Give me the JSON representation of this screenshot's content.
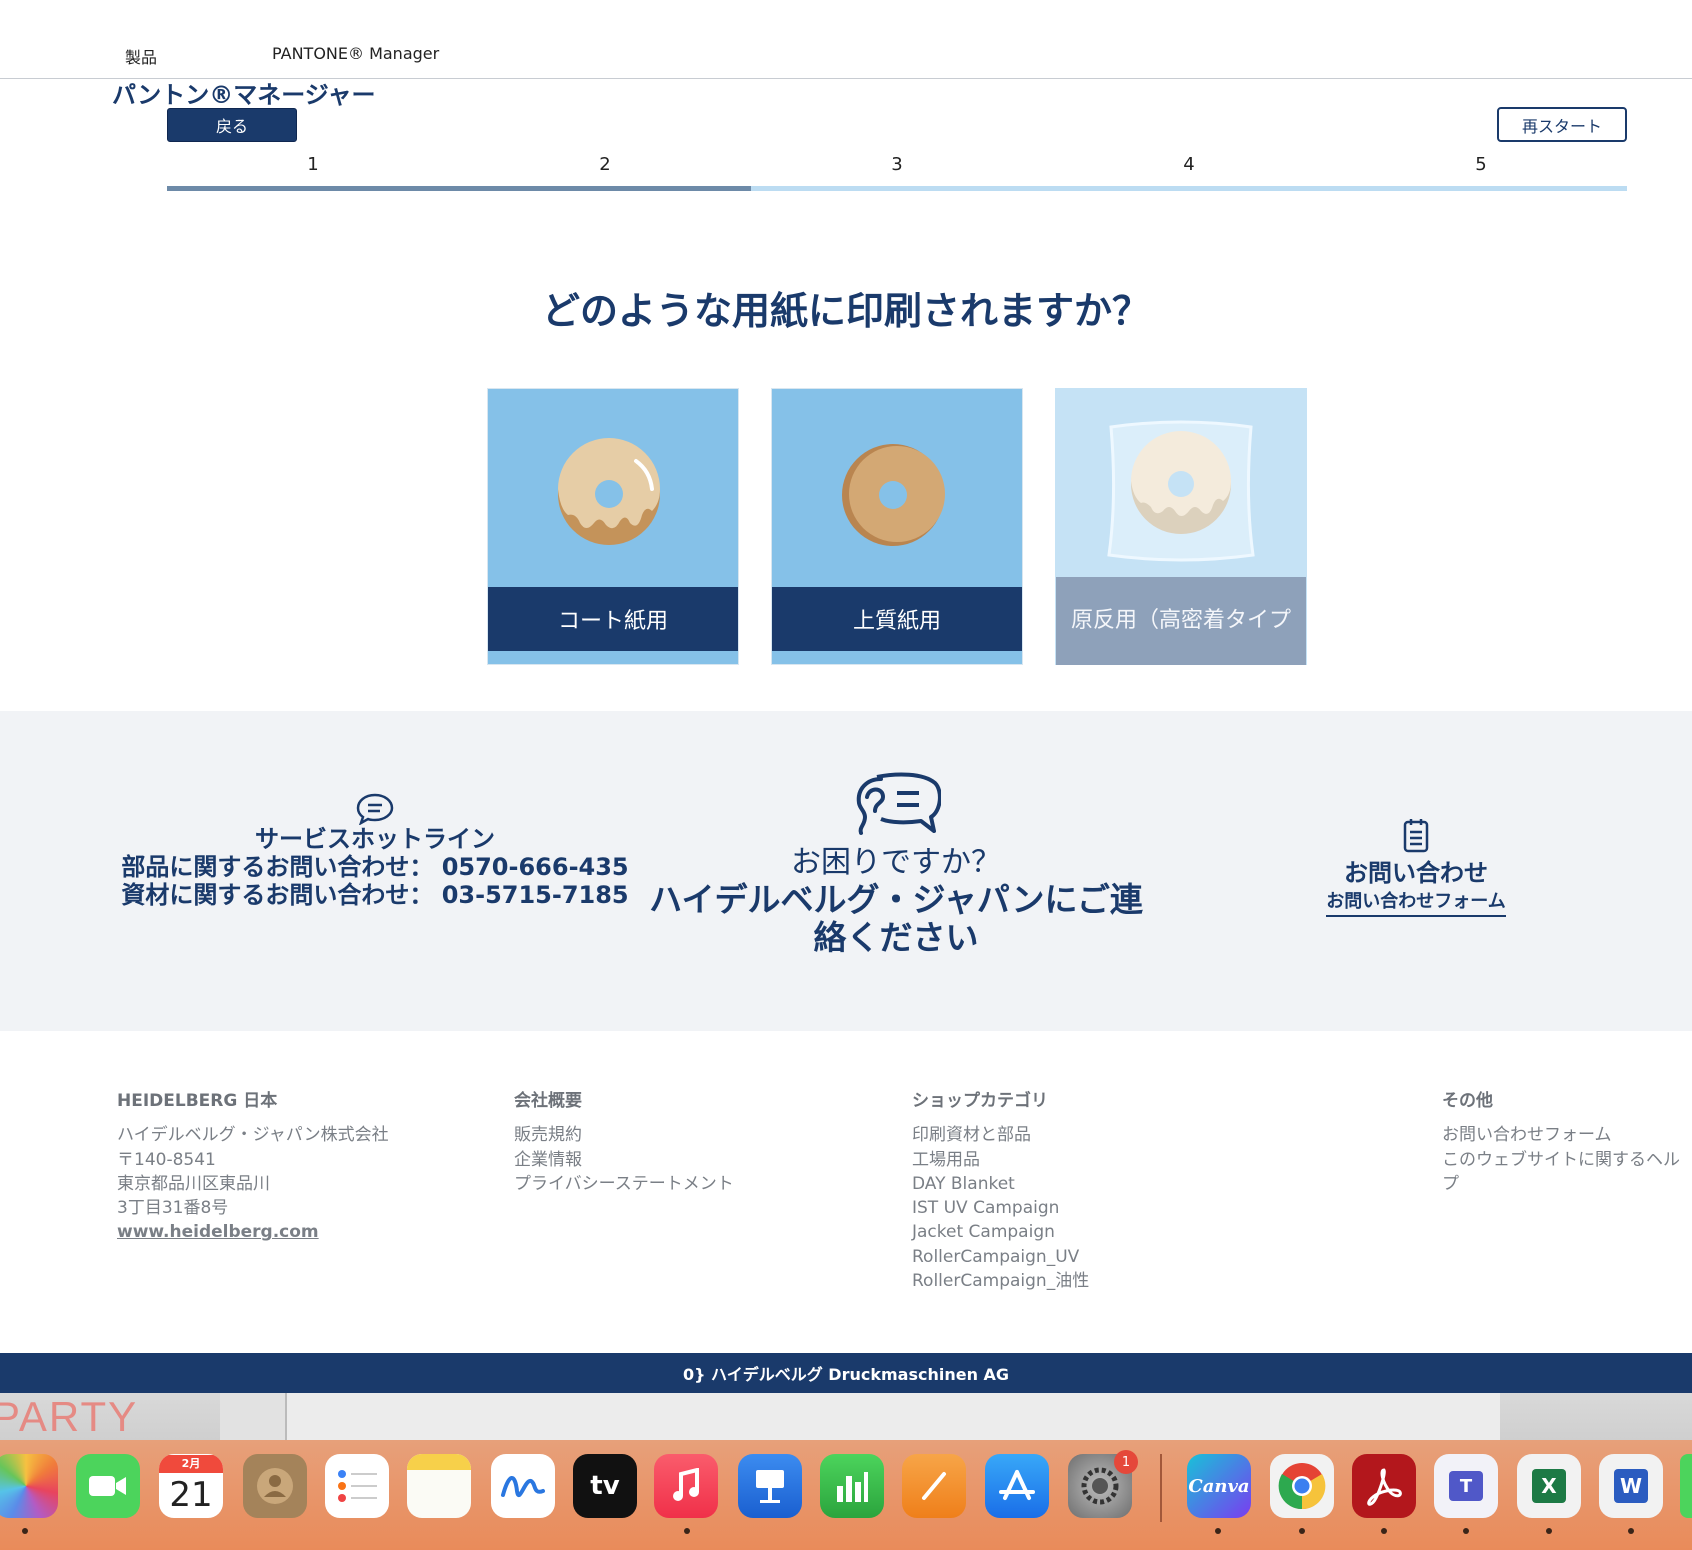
{
  "nav": {
    "products": "製品",
    "pantone": "PANTONE® Manager"
  },
  "page_title": "パントン®マネージャー",
  "buttons": {
    "back": "戻る",
    "restart": "再スタート"
  },
  "steps": [
    "1",
    "2",
    "3",
    "4",
    "5"
  ],
  "progress": {
    "current_step": 2,
    "total_steps": 5,
    "fill_fraction": 0.4
  },
  "question": "どのような用紙に印刷されますか？",
  "cards": [
    {
      "label": "コート紙用",
      "icon": "glazed-donut-icon",
      "enabled": true
    },
    {
      "label": "上質紙用",
      "icon": "plain-donut-icon",
      "enabled": true
    },
    {
      "label": "原反用（高密着タイプ",
      "icon": "wrapped-donut-icon",
      "enabled": false
    }
  ],
  "contact": {
    "hotline_title": "サービスホットライン",
    "parts_line": "部品に関するお問い合わせ： 0570-666-435",
    "materials_line": "資材に関するお問い合わせ： 03-5715-7185",
    "help_question": "お困りですか？",
    "help_body": "ハイデルベルグ・ジャパンにご連絡ください",
    "inquiry_title": "お問い合わせ",
    "inquiry_link": "お問い合わせフォーム"
  },
  "footer": {
    "col1": {
      "heading": "HEIDELBERG 日本",
      "lines": [
        "ハイデルベルグ・ジャパン株式会社",
        "〒140-8541",
        "東京都品川区東品川",
        "3丁目31番8号"
      ],
      "link": "www.heidelberg.com"
    },
    "col2": {
      "heading": "会社概要",
      "links": [
        "販売規約",
        "企業情報",
        "プライバシーステートメント"
      ]
    },
    "col3": {
      "heading": "ショップカテゴリ",
      "links": [
        "印刷資材と部品",
        "工場用品",
        "DAY Blanket",
        "IST UV Campaign",
        "Jacket Campaign",
        "RollerCampaign_UV",
        "RollerCampaign_油性"
      ]
    },
    "col4": {
      "heading": "その他",
      "links": [
        "お問い合わせフォーム",
        "このウェブサイトに関するヘルプ"
      ]
    }
  },
  "copyright": "0} ハイデルベルグ Druckmaschinen AG",
  "dock": {
    "calendar_month": "2月",
    "calendar_day": "21",
    "settings_badge": "1",
    "apps": [
      "photos-icon",
      "facetime-icon",
      "calendar-icon",
      "contacts-icon",
      "reminders-icon",
      "notes-icon",
      "freeform-icon",
      "apple-tv-icon",
      "music-icon",
      "keynote-icon",
      "numbers-icon",
      "pages-icon",
      "app-store-icon",
      "system-settings-icon",
      "canva-icon",
      "chrome-icon",
      "acrobat-icon",
      "teams-icon",
      "excel-icon",
      "word-icon"
    ],
    "labels": {
      "tv": "tv",
      "canva": "Canva",
      "excel": "X",
      "word": "W",
      "teams": "T"
    }
  },
  "background_window": {
    "party_text": "PARTY"
  },
  "colors": {
    "brand_navy": "#1a3a6b",
    "card_blue": "#85c1e8",
    "progress_light": "#bcdcf2",
    "progress_dark": "#6d8aa8",
    "contact_bg": "#f1f3f6"
  }
}
